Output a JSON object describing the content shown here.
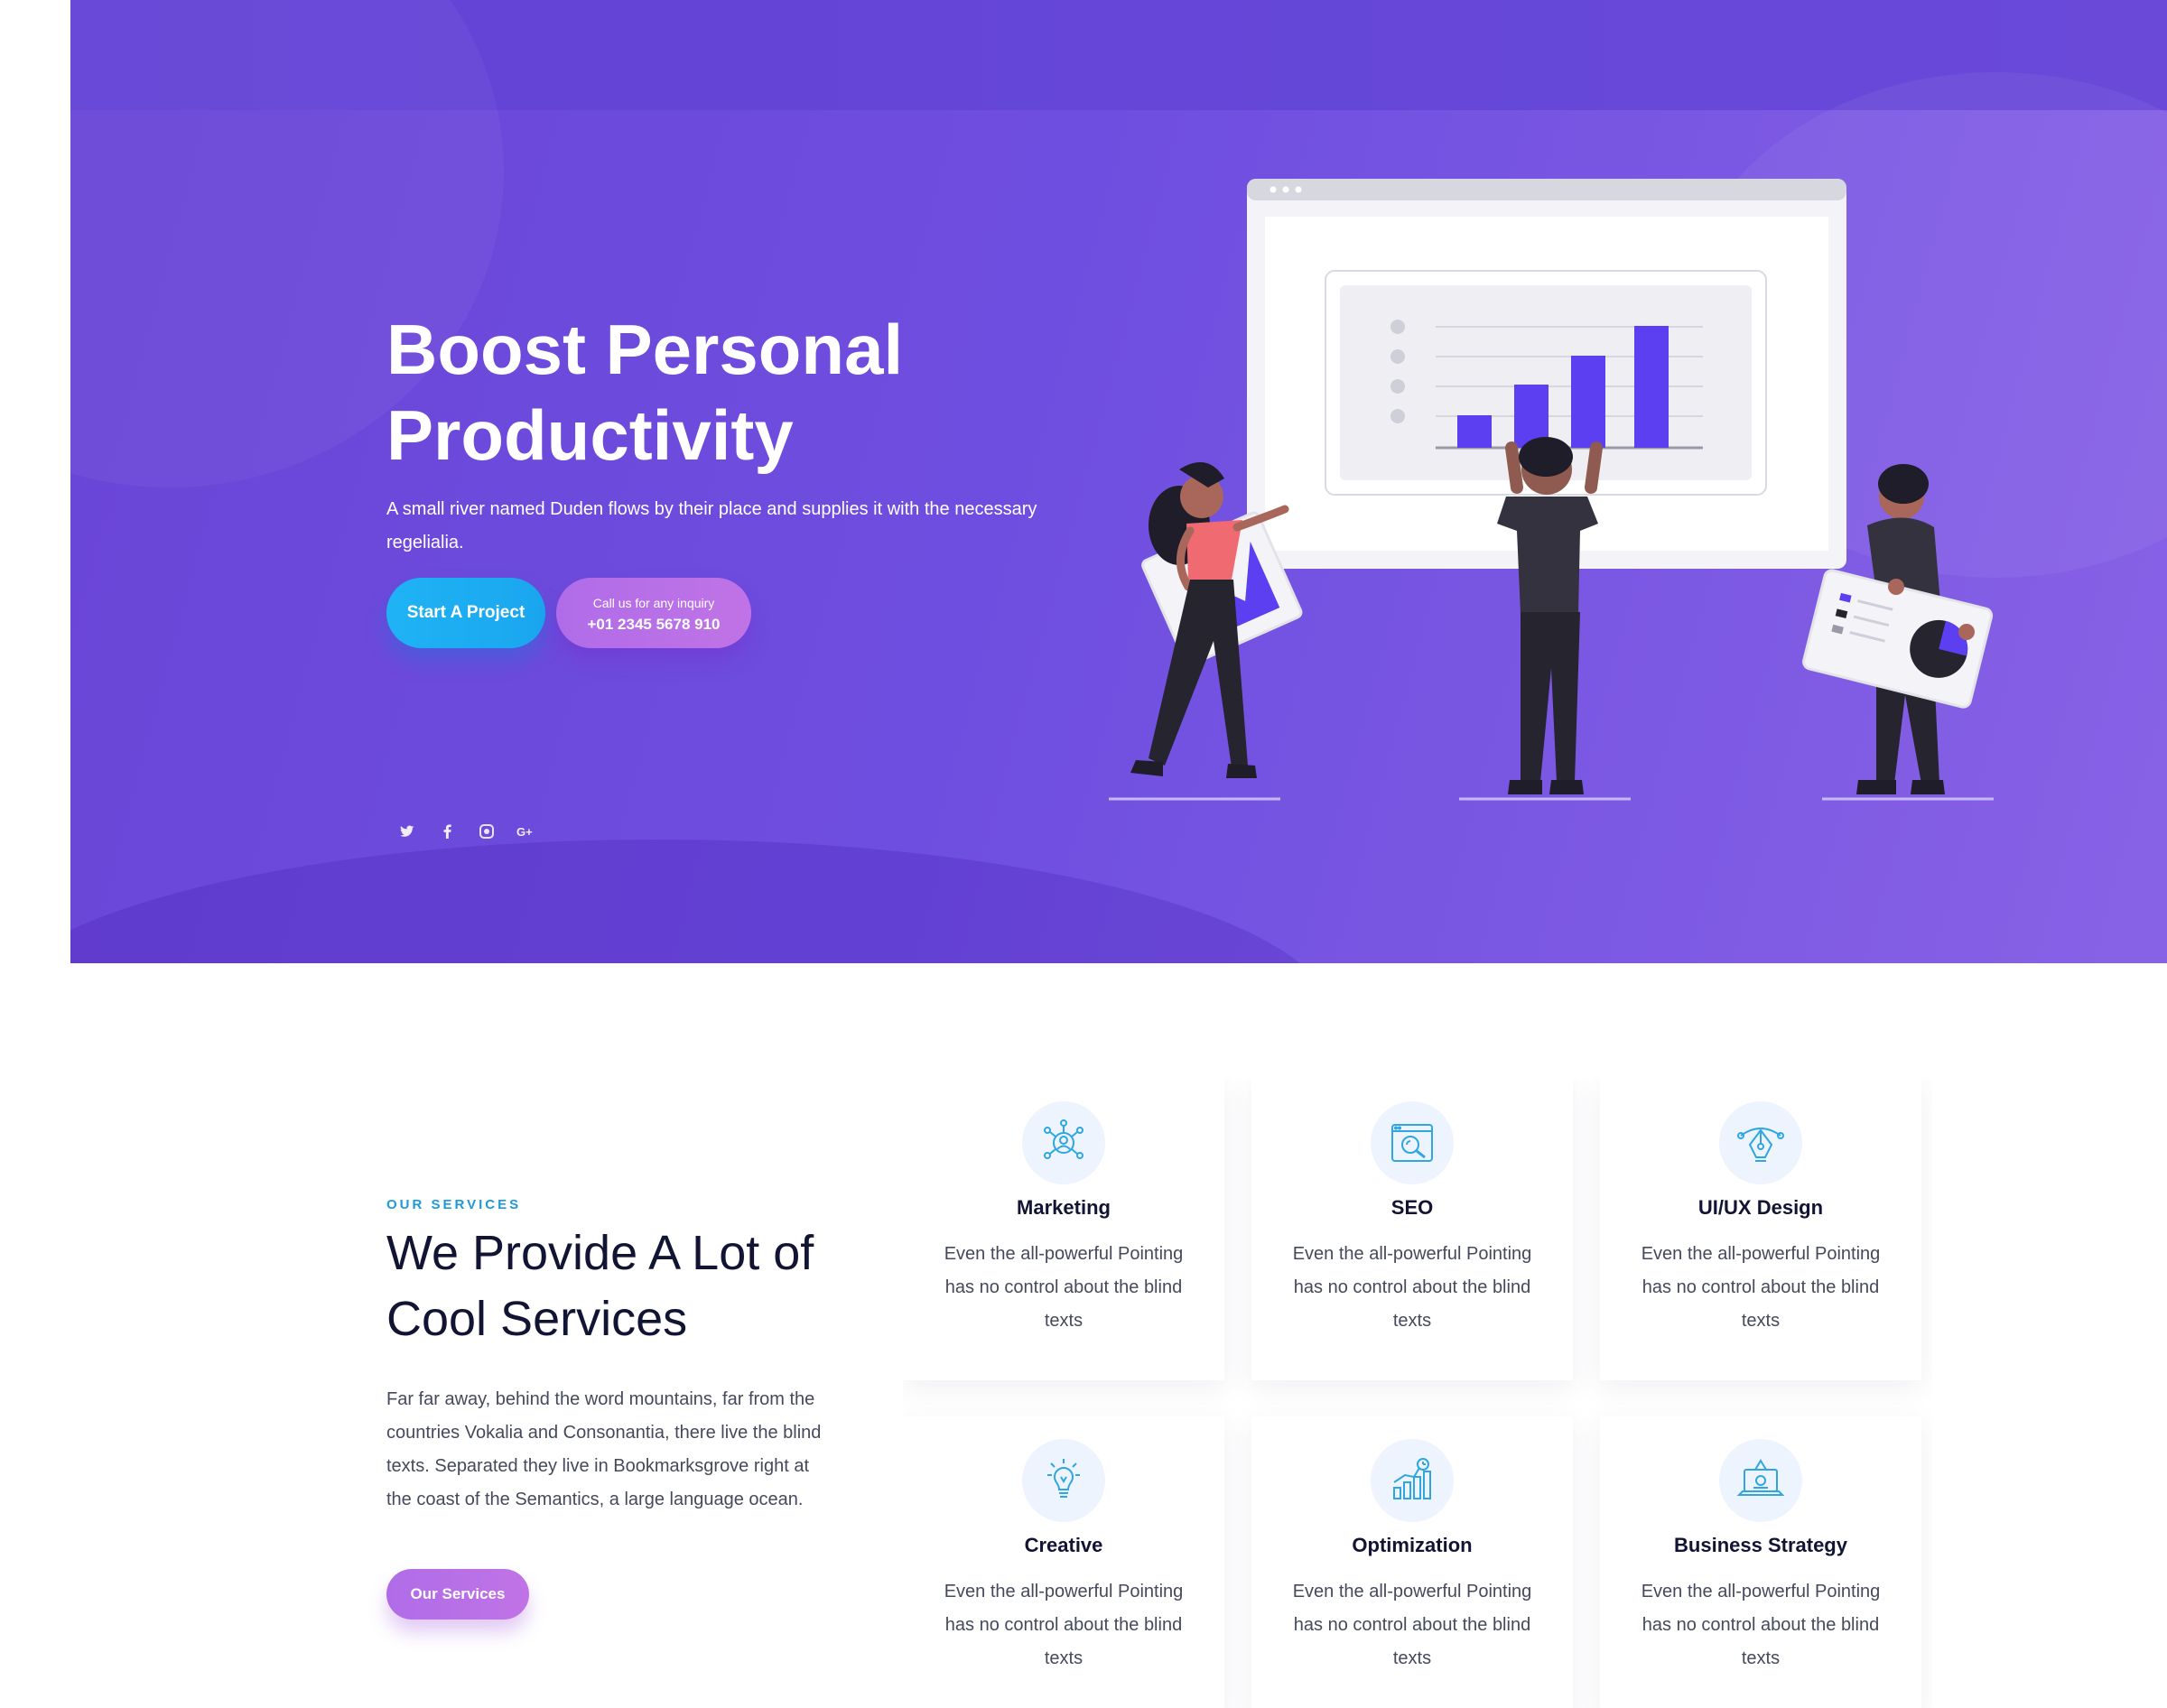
{
  "hero": {
    "title_line1": "Boost Personal",
    "title_line2": "Productivity",
    "subtitle": "A small river named Duden flows by their place and supplies it with the necessary regelialia.",
    "start_button": "Start A Project",
    "call_line1": "Call us for any inquiry",
    "call_line2": "+01 2345 5678 910",
    "socials": [
      "twitter-icon",
      "facebook-icon",
      "instagram-icon",
      "google-plus-icon"
    ]
  },
  "services": {
    "kicker": "OUR SERVICES",
    "title_line1": "We Provide A Lot of",
    "title_line2": "Cool Services",
    "description": "Far far away, behind the word mountains, far from the countries Vokalia and Consonantia, there live the blind texts. Separated they live in Bookmarksgrove right at the coast of the Semantics, a large language ocean.",
    "button": "Our Services",
    "cards": [
      {
        "title": "Marketing",
        "text": "Even the all-powerful Pointing has no control about the blind texts",
        "icon": "marketing-icon"
      },
      {
        "title": "SEO",
        "text": "Even the all-powerful Pointing has no control about the blind texts",
        "icon": "seo-icon"
      },
      {
        "title": "UI/UX Design",
        "text": "Even the all-powerful Pointing has no control about the blind texts",
        "icon": "design-pen-icon"
      },
      {
        "title": "Creative",
        "text": "Even the all-powerful Pointing has no control about the blind texts",
        "icon": "lightbulb-icon"
      },
      {
        "title": "Optimization",
        "text": "Even the all-powerful Pointing has no control about the blind texts",
        "icon": "optimization-chart-icon"
      },
      {
        "title": "Business Strategy",
        "text": "Even the all-powerful Pointing has no control about the blind texts",
        "icon": "strategy-laptop-icon"
      }
    ]
  },
  "colors": {
    "hero_bg": "#6a45d6",
    "accent_blue": "#1fb3f4",
    "accent_purple": "#b06ce8",
    "illustration_bar": "#5b3ff0",
    "icon_blue": "#2fa6e0"
  }
}
